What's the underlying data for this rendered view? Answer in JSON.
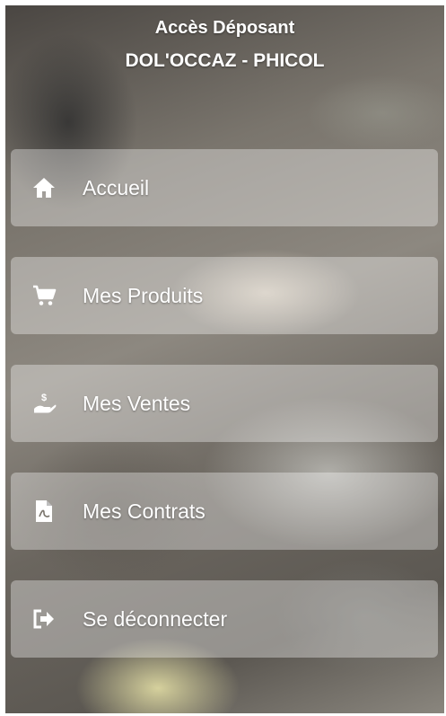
{
  "header": {
    "subtitle": "Accès Déposant",
    "title": "DOL'OCCAZ - PHICOL"
  },
  "menu": {
    "items": [
      {
        "label": "Accueil",
        "icon": "home-icon"
      },
      {
        "label": "Mes Produits",
        "icon": "shopping-cart-icon"
      },
      {
        "label": "Mes Ventes",
        "icon": "hand-money-icon"
      },
      {
        "label": "Mes Contrats",
        "icon": "pdf-file-icon"
      },
      {
        "label": "Se déconnecter",
        "icon": "logout-icon"
      }
    ]
  },
  "colors": {
    "text": "#ffffff",
    "item_background": "rgba(255,255,255,0.35)"
  }
}
